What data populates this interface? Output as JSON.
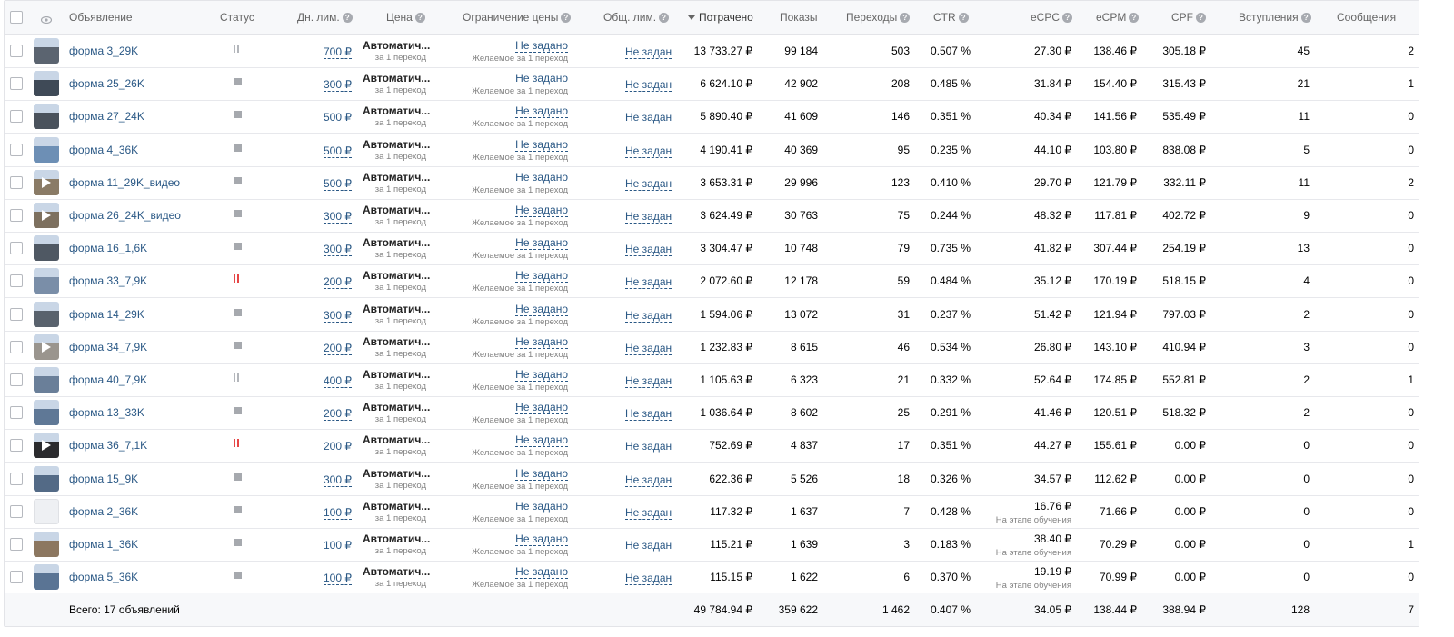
{
  "header": {
    "ad": "Объявление",
    "status": "Статус",
    "daily_limit": "Дн. лим.",
    "price": "Цена",
    "price_limit": "Ограничение цены",
    "total_limit": "Общ. лим.",
    "spent": "Потрачено",
    "impressions": "Показы",
    "clicks": "Переходы",
    "ctr": "CTR",
    "ecpc": "eCPC",
    "ecpm": "eCPM",
    "cpf": "CPF",
    "joins": "Вступления",
    "messages": "Сообщения"
  },
  "price_text": "Автоматич...",
  "price_sub": "за 1 переход",
  "price_limit_text": "Не задано",
  "price_limit_sub": "Желаемое за 1 переход",
  "total_limit_text": "Не задан",
  "learning_text": "На этапе обучения",
  "rows": [
    {
      "name": "форма 3_29K",
      "status": "paused",
      "daily": "700 ₽",
      "spent": "13 733.27 ₽",
      "impr": "99 184",
      "clicks": "503",
      "ctr": "0.507 %",
      "ecpc": "27.30 ₽",
      "ecpm": "138.46 ₽",
      "cpf": "305.18 ₽",
      "joins": "45",
      "msgs": "2",
      "learning": false,
      "thumb": "photo",
      "thumb_color": "#5b6470"
    },
    {
      "name": "форма 25_26K",
      "status": "stopped",
      "daily": "300 ₽",
      "spent": "6 624.10 ₽",
      "impr": "42 902",
      "clicks": "208",
      "ctr": "0.485 %",
      "ecpc": "31.84 ₽",
      "ecpm": "154.40 ₽",
      "cpf": "315.43 ₽",
      "joins": "21",
      "msgs": "1",
      "learning": false,
      "thumb": "photo",
      "thumb_color": "#3f4a57"
    },
    {
      "name": "форма 27_24K",
      "status": "stopped",
      "daily": "500 ₽",
      "spent": "5 890.40 ₽",
      "impr": "41 609",
      "clicks": "146",
      "ctr": "0.351 %",
      "ecpc": "40.34 ₽",
      "ecpm": "141.56 ₽",
      "cpf": "535.49 ₽",
      "joins": "11",
      "msgs": "0",
      "learning": false,
      "thumb": "photo",
      "thumb_color": "#4a525c"
    },
    {
      "name": "форма 4_36K",
      "status": "stopped",
      "daily": "500 ₽",
      "spent": "4 190.41 ₽",
      "impr": "40 369",
      "clicks": "95",
      "ctr": "0.235 %",
      "ecpc": "44.10 ₽",
      "ecpm": "103.80 ₽",
      "cpf": "838.08 ₽",
      "joins": "5",
      "msgs": "0",
      "learning": false,
      "thumb": "photo",
      "thumb_color": "#6d8fb5"
    },
    {
      "name": "форма 11_29K_видео",
      "status": "stopped",
      "daily": "500 ₽",
      "spent": "3 653.31 ₽",
      "impr": "29 996",
      "clicks": "123",
      "ctr": "0.410 %",
      "ecpc": "29.70 ₽",
      "ecpm": "121.79 ₽",
      "cpf": "332.11 ₽",
      "joins": "11",
      "msgs": "2",
      "learning": false,
      "thumb": "video",
      "thumb_color": "#8a7b66"
    },
    {
      "name": "форма 26_24K_видео",
      "status": "stopped",
      "daily": "300 ₽",
      "spent": "3 624.49 ₽",
      "impr": "30 763",
      "clicks": "75",
      "ctr": "0.244 %",
      "ecpc": "48.32 ₽",
      "ecpm": "117.81 ₽",
      "cpf": "402.72 ₽",
      "joins": "9",
      "msgs": "0",
      "learning": false,
      "thumb": "video",
      "thumb_color": "#7d705f"
    },
    {
      "name": "форма 16_1,6K",
      "status": "stopped",
      "daily": "300 ₽",
      "spent": "3 304.47 ₽",
      "impr": "10 748",
      "clicks": "79",
      "ctr": "0.735 %",
      "ecpc": "41.82 ₽",
      "ecpm": "307.44 ₽",
      "cpf": "254.19 ₽",
      "joins": "13",
      "msgs": "0",
      "learning": false,
      "thumb": "photo",
      "thumb_color": "#4f5863"
    },
    {
      "name": "форма 33_7,9K",
      "status": "paused-red",
      "daily": "200 ₽",
      "spent": "2 072.60 ₽",
      "impr": "12 178",
      "clicks": "59",
      "ctr": "0.484 %",
      "ecpc": "35.12 ₽",
      "ecpm": "170.19 ₽",
      "cpf": "518.15 ₽",
      "joins": "4",
      "msgs": "0",
      "learning": false,
      "thumb": "photo",
      "thumb_color": "#7a8ea8"
    },
    {
      "name": "форма 14_29K",
      "status": "stopped",
      "daily": "300 ₽",
      "spent": "1 594.06 ₽",
      "impr": "13 072",
      "clicks": "31",
      "ctr": "0.237 %",
      "ecpc": "51.42 ₽",
      "ecpm": "121.94 ₽",
      "cpf": "797.03 ₽",
      "joins": "2",
      "msgs": "0",
      "learning": false,
      "thumb": "photo",
      "thumb_color": "#59626d"
    },
    {
      "name": "форма 34_7,9K",
      "status": "stopped",
      "daily": "200 ₽",
      "spent": "1 232.83 ₽",
      "impr": "8 615",
      "clicks": "46",
      "ctr": "0.534 %",
      "ecpc": "26.80 ₽",
      "ecpm": "143.10 ₽",
      "cpf": "410.94 ₽",
      "joins": "3",
      "msgs": "0",
      "learning": false,
      "thumb": "video",
      "thumb_color": "#9a958e"
    },
    {
      "name": "форма 40_7,9K",
      "status": "paused",
      "daily": "400 ₽",
      "spent": "1 105.63 ₽",
      "impr": "6 323",
      "clicks": "21",
      "ctr": "0.332 %",
      "ecpc": "52.64 ₽",
      "ecpm": "174.85 ₽",
      "cpf": "552.81 ₽",
      "joins": "2",
      "msgs": "1",
      "learning": false,
      "thumb": "photo",
      "thumb_color": "#6a7f99"
    },
    {
      "name": "форма 13_33K",
      "status": "stopped",
      "daily": "200 ₽",
      "spent": "1 036.64 ₽",
      "impr": "8 602",
      "clicks": "25",
      "ctr": "0.291 %",
      "ecpc": "41.46 ₽",
      "ecpm": "120.51 ₽",
      "cpf": "518.32 ₽",
      "joins": "2",
      "msgs": "0",
      "learning": false,
      "thumb": "photo",
      "thumb_color": "#5f7896"
    },
    {
      "name": "форма 36_7,1K",
      "status": "paused-red",
      "daily": "200 ₽",
      "spent": "752.69 ₽",
      "impr": "4 837",
      "clicks": "17",
      "ctr": "0.351 %",
      "ecpc": "44.27 ₽",
      "ecpm": "155.61 ₽",
      "cpf": "0.00 ₽",
      "joins": "0",
      "msgs": "0",
      "learning": false,
      "thumb": "video",
      "thumb_color": "#2b2b2e"
    },
    {
      "name": "форма 15_9K",
      "status": "stopped",
      "daily": "300 ₽",
      "spent": "622.36 ₽",
      "impr": "5 526",
      "clicks": "18",
      "ctr": "0.326 %",
      "ecpc": "34.57 ₽",
      "ecpm": "112.62 ₽",
      "cpf": "0.00 ₽",
      "joins": "0",
      "msgs": "0",
      "learning": false,
      "thumb": "photo",
      "thumb_color": "#536a86"
    },
    {
      "name": "форма 2_36K",
      "status": "stopped",
      "daily": "100 ₽",
      "spent": "117.32 ₽",
      "impr": "1 637",
      "clicks": "7",
      "ctr": "0.428 %",
      "ecpc": "16.76 ₽",
      "ecpm": "71.66 ₽",
      "cpf": "0.00 ₽",
      "joins": "0",
      "msgs": "0",
      "learning": true,
      "thumb": "blank",
      "thumb_color": "#eef0f3"
    },
    {
      "name": "форма 1_36K",
      "status": "stopped",
      "daily": "100 ₽",
      "spent": "115.21 ₽",
      "impr": "1 639",
      "clicks": "3",
      "ctr": "0.183 %",
      "ecpc": "38.40 ₽",
      "ecpm": "70.29 ₽",
      "cpf": "0.00 ₽",
      "joins": "0",
      "msgs": "1",
      "learning": true,
      "thumb": "photo",
      "thumb_color": "#8c7760"
    },
    {
      "name": "форма 5_36K",
      "status": "stopped",
      "daily": "100 ₽",
      "spent": "115.15 ₽",
      "impr": "1 622",
      "clicks": "6",
      "ctr": "0.370 %",
      "ecpc": "19.19 ₽",
      "ecpm": "70.99 ₽",
      "cpf": "0.00 ₽",
      "joins": "0",
      "msgs": "0",
      "learning": true,
      "thumb": "photo",
      "thumb_color": "#5a7494"
    }
  ],
  "totals": {
    "label": "Всего: 17 объявлений",
    "spent": "49 784.94 ₽",
    "impr": "359 622",
    "clicks": "1 462",
    "ctr": "0.407 %",
    "ecpc": "34.05 ₽",
    "ecpm": "138.44 ₽",
    "cpf": "388.94 ₽",
    "joins": "128",
    "msgs": "7"
  }
}
